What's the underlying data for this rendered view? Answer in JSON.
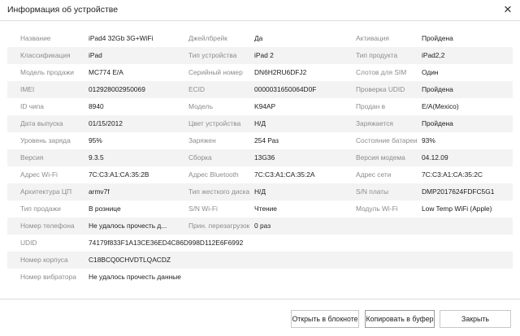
{
  "window": {
    "title": "Информация об устройстве",
    "close_glyph": "✕"
  },
  "rows": [
    {
      "c1": {
        "label": "Название",
        "value": "iPad4 32Gb 3G+WiFi"
      },
      "c2": {
        "label": "Джейлбрейк",
        "value": "Да"
      },
      "c3": {
        "label": "Активация",
        "value": "Пройдена"
      }
    },
    {
      "c1": {
        "label": "Классификация",
        "value": "iPad"
      },
      "c2": {
        "label": "Тип устройства",
        "value": "iPad 2"
      },
      "c3": {
        "label": "Тип продукта",
        "value": "iPad2,2"
      }
    },
    {
      "c1": {
        "label": "Модель продажи",
        "value": "MC774 E/A"
      },
      "c2": {
        "label": "Серийный номер",
        "value": "DN6H2RU6DFJ2"
      },
      "c3": {
        "label": "Слотов для SIM",
        "value": "Один"
      }
    },
    {
      "c1": {
        "label": "IMEI",
        "value": "012928002950069"
      },
      "c2": {
        "label": "ECID",
        "value": "0000031650064D0F"
      },
      "c3": {
        "label": "Проверка UDID",
        "value": "Пройдена"
      }
    },
    {
      "c1": {
        "label": "ID чипа",
        "value": "8940"
      },
      "c2": {
        "label": "Модель",
        "value": "K94AP"
      },
      "c3": {
        "label": "Продан в",
        "value": "E/A(Mexico)"
      }
    },
    {
      "c1": {
        "label": "Дата выпуска",
        "value": "01/15/2012"
      },
      "c2": {
        "label": "Цвет устройства",
        "value": "Н/Д"
      },
      "c3": {
        "label": "Заряжается",
        "value": "Пройдена"
      }
    },
    {
      "c1": {
        "label": "Уровень заряда",
        "value": "95%"
      },
      "c2": {
        "label": "Заряжен",
        "value": "254 Раз"
      },
      "c3": {
        "label": "Состояние батареи",
        "value": "93%"
      }
    },
    {
      "c1": {
        "label": "Версия",
        "value": "9.3.5"
      },
      "c2": {
        "label": "Сборка",
        "value": "13G36"
      },
      "c3": {
        "label": "Версия модема",
        "value": "04.12.09"
      }
    },
    {
      "c1": {
        "label": "Адрес Wi-Fi",
        "value": "7C:C3:A1:CA:35:2B"
      },
      "c2": {
        "label": "Адрес Bluetooth",
        "value": "7C:C3:A1:CA:35:2A"
      },
      "c3": {
        "label": "Адрес сети",
        "value": "7C:C3:A1:CA:35:2C"
      }
    },
    {
      "c1": {
        "label": "Архитектура ЦП",
        "value": "armv7f"
      },
      "c2": {
        "label": "Тип жесткого диска",
        "value": "Н/Д"
      },
      "c3": {
        "label": "S/N платы",
        "value": "DMP2017624FDFC5G1"
      }
    },
    {
      "c1": {
        "label": "Тип продажи",
        "value": "В рознице"
      },
      "c2": {
        "label": "S/N Wi-Fi",
        "value": "Чтение"
      },
      "c3": {
        "label": "Модуль Wi-Fi",
        "value": "Low Temp WiFi (Apple)"
      }
    },
    {
      "c1": {
        "label": "Номер телефона",
        "value": "Не удалось прочесть д..."
      },
      "c2": {
        "label": "Прин. перезагрузок",
        "value": "0 раз"
      }
    },
    {
      "c1": {
        "label": "UDID",
        "value": "74179f833F1A13CE36ED4C86D998D112E6F6992"
      }
    },
    {
      "c1": {
        "label": "Номер корпуса",
        "value": "C18BCQ0CHVDTLQACDZ"
      }
    },
    {
      "c1": {
        "label": "Номер вибратора",
        "value": "Не удалось прочесть данные"
      }
    }
  ],
  "footer": {
    "notepad_label": "Открыть в блокноте",
    "copy_label": "Копировать в буфер",
    "close_label": "Закрыть"
  }
}
